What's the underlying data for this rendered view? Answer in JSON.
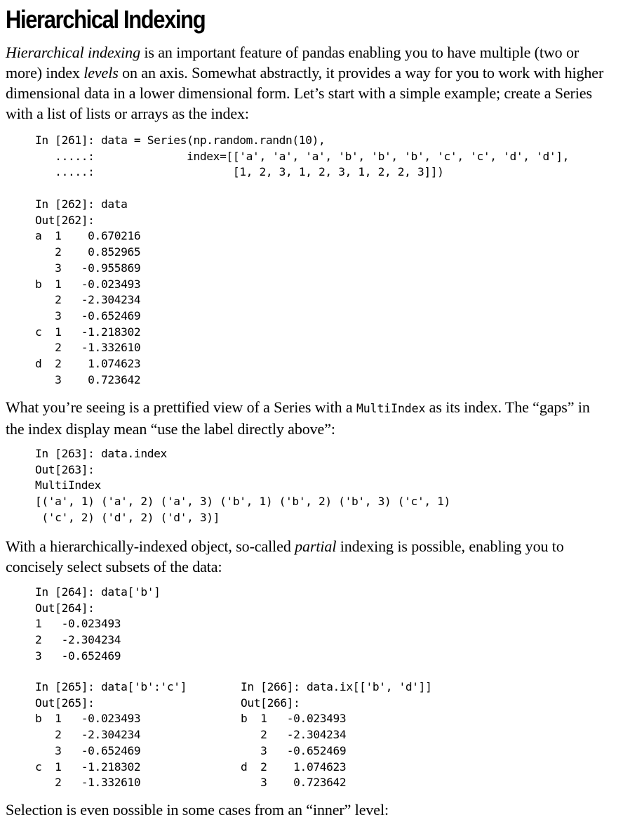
{
  "heading": "Hierarchical Indexing",
  "paragraphs": {
    "intro": {
      "term1": "Hierarchical indexing",
      "text1": " is an important feature of pandas enabling you to have multiple (two or more) index ",
      "term2": "levels",
      "text2": " on an axis. Somewhat abstractly, it provides a way for you to work with higher dimensional data in a lower dimensional form. Let’s start with a simple example; create a Series with a list of lists or arrays as the index:"
    },
    "prettified": {
      "text1": "What you’re seeing is a prettified view of a Series with a ",
      "code": "MultiIndex",
      "text2": " as its index. The “gaps” in the index display mean “use the label directly above”:"
    },
    "partial": {
      "text1": "With a hierarchically-indexed object, so-called ",
      "term": "partial",
      "text2": " indexing is possible, enabling you to concisely select subsets of the data:"
    },
    "inner": "Selection is even possible in some cases from an “inner” level:"
  },
  "code_blocks": {
    "in261": "In [261]: data = Series(np.random.randn(10),\n   .....:              index=[['a', 'a', 'a', 'b', 'b', 'b', 'c', 'c', 'd', 'd'],\n   .....:                     [1, 2, 3, 1, 2, 3, 1, 2, 2, 3]])",
    "in262": "In [262]: data\nOut[262]:\na  1    0.670216\n   2    0.852965\n   3   -0.955869\nb  1   -0.023493\n   2   -2.304234\n   3   -0.652469\nc  1   -1.218302\n   2   -1.332610\nd  2    1.074623\n   3    0.723642",
    "in263": "In [263]: data.index\nOut[263]:\nMultiIndex\n[('a', 1) ('a', 2) ('a', 3) ('b', 1) ('b', 2) ('b', 3) ('c', 1)\n ('c', 2) ('d', 2) ('d', 3)]",
    "in264": "In [264]: data['b']\nOut[264]:\n1   -0.023493\n2   -2.304234\n3   -0.652469",
    "in265": "In [265]: data['b':'c']\nOut[265]:\nb  1   -0.023493\n   2   -2.304234\n   3   -0.652469\nc  1   -1.218302\n   2   -1.332610",
    "in266": "In [266]: data.ix[['b', 'd']]\nOut[266]:\nb  1   -0.023493\n   2   -2.304234\n   3   -0.652469\nd  2    1.074623\n   3    0.723642"
  }
}
